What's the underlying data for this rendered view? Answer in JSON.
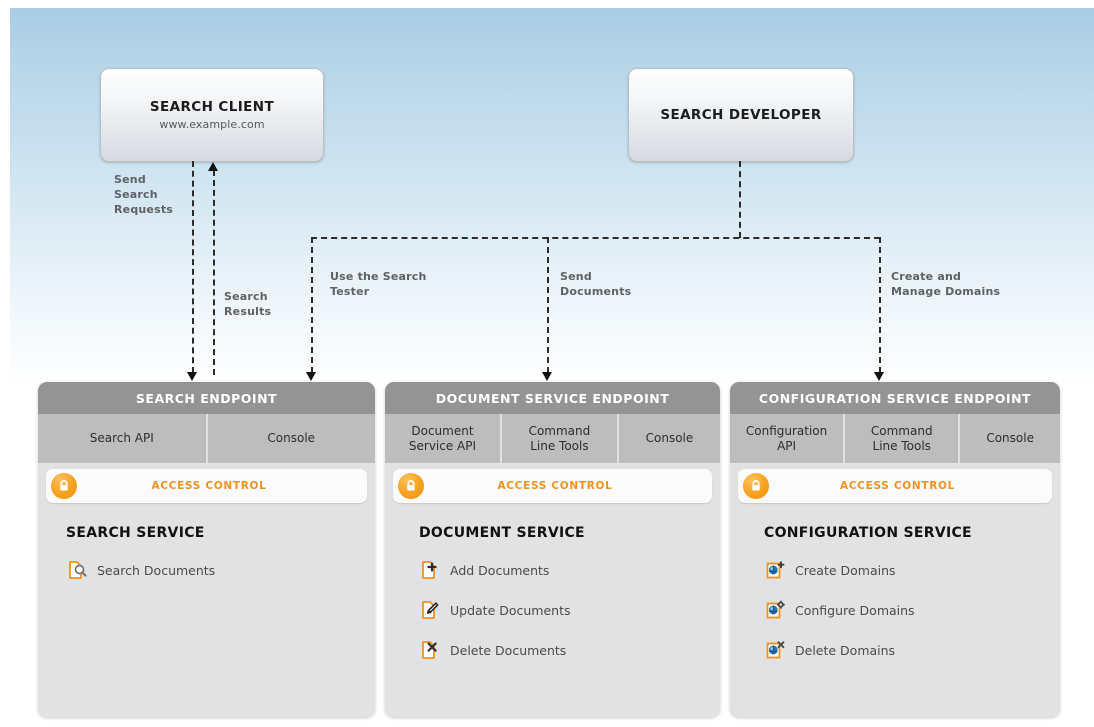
{
  "actors": [
    {
      "id": "search-client",
      "title": "SEARCH CLIENT",
      "subtitle": "www.example.com"
    },
    {
      "id": "search-developer",
      "title": "SEARCH DEVELOPER",
      "subtitle": ""
    }
  ],
  "flows": [
    {
      "id": "send-search-requests",
      "label": "Send\nSearch\nRequests",
      "direction": "down"
    },
    {
      "id": "search-results",
      "label": "Search\nResults",
      "direction": "up"
    },
    {
      "id": "use-the-search-tester",
      "label": "Use the Search\nTester",
      "direction": "down"
    },
    {
      "id": "send-documents",
      "label": "Send\nDocuments",
      "direction": "down"
    },
    {
      "id": "create-and-manage-domains",
      "label": "Create and\nManage Domains",
      "direction": "down"
    }
  ],
  "panels": [
    {
      "id": "search-endpoint",
      "header": "SEARCH ENDPOINT",
      "tabs": [
        "Search API",
        "Console"
      ],
      "access_control": {
        "label": "ACCESS CONTROL",
        "icon": "lock-icon",
        "color": "#f0921b"
      },
      "service_title": "SEARCH SERVICE",
      "items": [
        {
          "label": "Search Documents",
          "icon": "document-search-icon"
        }
      ]
    },
    {
      "id": "document-service-endpoint",
      "header": "DOCUMENT SERVICE ENDPOINT",
      "tabs": [
        "Document\nService API",
        "Command\nLine Tools",
        "Console"
      ],
      "access_control": {
        "label": "ACCESS CONTROL",
        "icon": "lock-icon",
        "color": "#f0921b"
      },
      "service_title": "DOCUMENT SERVICE",
      "items": [
        {
          "label": "Add Documents",
          "icon": "document-add-icon"
        },
        {
          "label": "Update Documents",
          "icon": "document-edit-icon"
        },
        {
          "label": "Delete Documents",
          "icon": "document-delete-icon"
        }
      ]
    },
    {
      "id": "configuration-service-endpoint",
      "header": "CONFIGURATION SERVICE ENDPOINT",
      "tabs": [
        "Configuration\nAPI",
        "Command\nLine Tools",
        "Console"
      ],
      "access_control": {
        "label": "ACCESS CONTROL",
        "icon": "lock-icon",
        "color": "#f0921b"
      },
      "service_title": "CONFIGURATION SERVICE",
      "items": [
        {
          "label": "Create Domains",
          "icon": "domain-add-icon"
        },
        {
          "label": "Configure Domains",
          "icon": "domain-configure-icon"
        },
        {
          "label": "Delete Domains",
          "icon": "domain-delete-icon"
        }
      ]
    }
  ],
  "colors": {
    "accent_orange": "#f0921b",
    "panel_header_gray": "#949494",
    "tab_gray": "#bdbdbd",
    "panel_body_gray": "#e2e2e2",
    "background_top": "#a9cde5"
  }
}
